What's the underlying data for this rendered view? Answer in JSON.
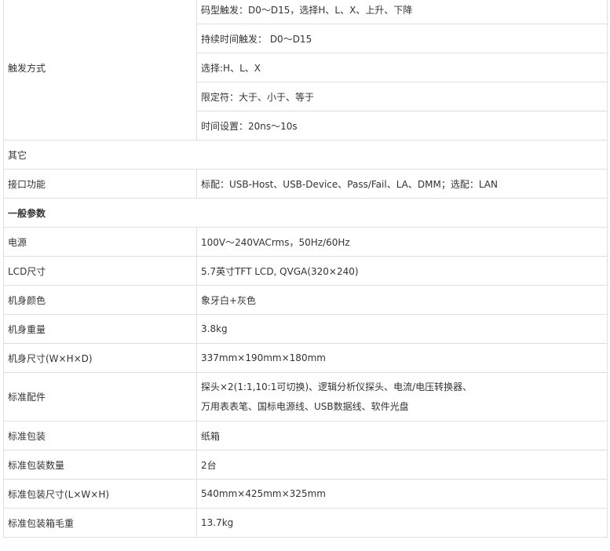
{
  "trigger": {
    "label": "触发方式",
    "items": [
      "码型触发：D0～D15，选择H、L、X、上升、下降",
      "持续时间触发： D0～D15",
      "选择:H、L、X",
      "限定符：大于、小于、等于",
      "时间设置：20ns～10s"
    ]
  },
  "other": {
    "section": "其它",
    "interface_label": "接口功能",
    "interface_value": "标配：USB-Host、USB-Device、Pass/Fail、LA、DMM；选配：LAN"
  },
  "general": {
    "section": "一般参数",
    "rows": [
      {
        "label": "电源",
        "value": "100V～240VACrms，50Hz/60Hz"
      },
      {
        "label": "LCD尺寸",
        "value": "5.7英寸TFT LCD, QVGA(320×240)"
      },
      {
        "label": "机身颜色",
        "value": "象牙白+灰色"
      },
      {
        "label": "机身重量",
        "value": "3.8kg"
      },
      {
        "label": "机身尺寸(W×H×D)",
        "value": "337mm×190mm×180mm"
      }
    ],
    "accessories": {
      "label": "标准配件",
      "line1": "探头×2(1:1,10:1可切换)、逻辑分析仪探头、电流/电压转换器、",
      "line2": "万用表表笔、国标电源线、USB数据线、软件光盘"
    },
    "rows2": [
      {
        "label": "标准包装",
        "value": "纸箱"
      },
      {
        "label": "标准包装数量",
        "value": "2台"
      },
      {
        "label": "标准包装尺寸(L×W×H)",
        "value": "540mm×425mm×325mm"
      },
      {
        "label": "标准包装箱毛重",
        "value": "13.7kg"
      }
    ]
  }
}
